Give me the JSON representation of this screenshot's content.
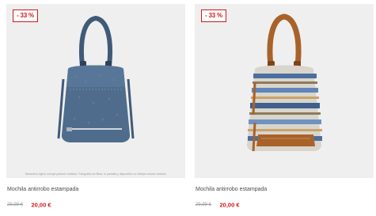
{
  "products": [
    {
      "discount_badge": "- 33 %",
      "title": "Mochila antirrobo estampada",
      "old_price": "29,99 €",
      "new_price": "20,00 €",
      "image_disclaimer": "Bandolera ligera, incluye pañuelo doblado. Fotografía sin filtrar, tu pantalla y dispositivo no reflejan colores exactos"
    },
    {
      "discount_badge": "- 33 %",
      "title": "Mochila antirrobo estampada",
      "old_price": "29,99 €",
      "new_price": "20,00 €"
    }
  ],
  "colors": {
    "accent_red": "#d21a1a",
    "image_background": "#efefef",
    "text_gray": "#4a4a4a",
    "denim_blue": "#4f6c8c",
    "tan_leather": "#a8622a"
  }
}
